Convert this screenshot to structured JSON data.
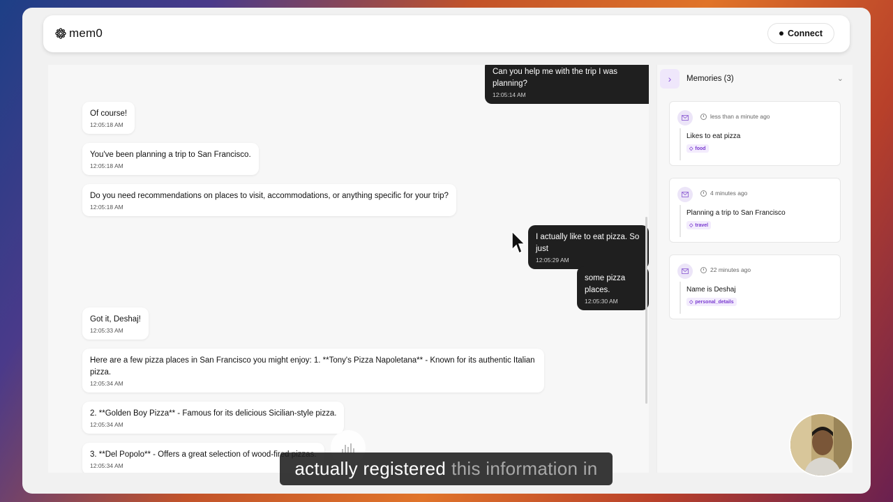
{
  "app": {
    "name": "mem0",
    "connect_label": "Connect"
  },
  "messages": [
    {
      "role": "user",
      "text": "Can you help me with the trip I was planning?",
      "time": "12:05:14 AM"
    },
    {
      "role": "bot",
      "text": "Of course!",
      "time": "12:05:18 AM"
    },
    {
      "role": "bot",
      "text": "You've been planning a trip to San Francisco.",
      "time": "12:05:18 AM"
    },
    {
      "role": "bot",
      "text": "Do you need recommendations on places to visit, accommodations, or anything specific for your trip?",
      "time": "12:05:18 AM"
    },
    {
      "role": "user",
      "text": "I actually like to eat pizza. So just",
      "time": "12:05:29 AM"
    },
    {
      "role": "user",
      "text": "some pizza places.",
      "time": "12:05:30 AM"
    },
    {
      "role": "bot",
      "text": "Got it, Deshaj!",
      "time": "12:05:33 AM"
    },
    {
      "role": "bot",
      "text": "Here are a few pizza places in San Francisco you might enjoy: 1. **Tony's Pizza Napoletana** - Known for its authentic Italian pizza.",
      "time": "12:05:34 AM"
    },
    {
      "role": "bot",
      "text": "2. **Golden Boy Pizza** - Famous for its delicious Sicilian-style pizza.",
      "time": "12:05:34 AM"
    },
    {
      "role": "bot",
      "text": "3. **Del Popolo** - Offers a great selection of wood-fired pizzas.",
      "time": "12:05:34 AM"
    }
  ],
  "memories": {
    "title": "Memories (3)",
    "items": [
      {
        "time": "less than a minute ago",
        "text": "Likes to eat pizza",
        "tag": "food"
      },
      {
        "time": "4 minutes ago",
        "text": "Planning a trip to San Francisco",
        "tag": "travel"
      },
      {
        "time": "22 minutes ago",
        "text": "Name is Deshaj",
        "tag": "personal_details"
      }
    ]
  },
  "subtitle": {
    "highlight": "actually registered",
    "rest": "this information in"
  },
  "colors": {
    "accent": "#8a56d8",
    "user_bubble": "#1f1f1f",
    "tag_bg": "#f3ecfd"
  }
}
